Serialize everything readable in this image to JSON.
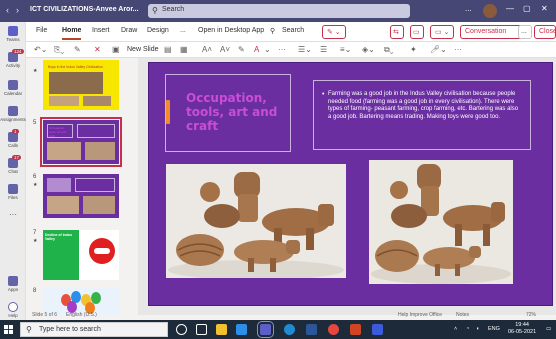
{
  "window": {
    "title": "ICT CIVILIZATIONS-Anvee Aror...",
    "search_placeholder": "Search",
    "more": "...",
    "minimize": "—",
    "maximize": "▢",
    "close": "✕"
  },
  "rail": {
    "items": [
      {
        "label": "Teams",
        "badge": ""
      },
      {
        "label": "Activity",
        "badge": "124"
      },
      {
        "label": "Calendar",
        "badge": ""
      },
      {
        "label": "Assignments",
        "badge": ""
      },
      {
        "label": "Calls",
        "badge": "1"
      },
      {
        "label": "Chat",
        "badge": "17"
      },
      {
        "label": "Files",
        "badge": ""
      },
      {
        "label": "Apps",
        "badge": ""
      },
      {
        "label": "Help",
        "badge": ""
      }
    ]
  },
  "tabs": {
    "file": "File",
    "home": "Home",
    "insert": "Insert",
    "draw": "Draw",
    "design": "Design",
    "more": "...",
    "open_desktop": "Open in Desktop App",
    "search": "Search",
    "conversation": "Conversation",
    "more2": "...",
    "close": "Close"
  },
  "ribbon": {
    "new_slide": "New Slide"
  },
  "thumbnails": [
    {
      "num": "",
      "title": "Boys in the Indus Valley Civilization"
    },
    {
      "num": "5",
      "title": "Occupation, tools, art and craft"
    },
    {
      "num": "6",
      "title": ""
    },
    {
      "num": "7",
      "title": "Decline of Indus Valley"
    },
    {
      "num": "8",
      "title": ""
    }
  ],
  "slide": {
    "title": "Occupation, tools, art and craft",
    "body": "Farming was a good job in the Indus Valley civilisation because people needed food (farming was a good job in every civilisation). There were types of farming- peasant farming, crop farming, etc. Bartering was also a good job. Bartering means trading. Making toys were good too.",
    "bullet": "•"
  },
  "statusbar": {
    "slide_info": "Slide 5 of 6",
    "language": "English (U.S.)",
    "help": "Help Improve Office",
    "notes": "Notes",
    "zoom": "72%"
  },
  "taskbar": {
    "search_placeholder": "Type here to search",
    "lang": "ENG",
    "time": "19:44",
    "date": "06-05-2021"
  },
  "colors": {
    "teams_purple": "#464775",
    "ppt_red": "#c4314b",
    "slide_bg": "#6a2ea1",
    "title_pink": "#c94dd8",
    "accent_orange": "#f28c28"
  }
}
